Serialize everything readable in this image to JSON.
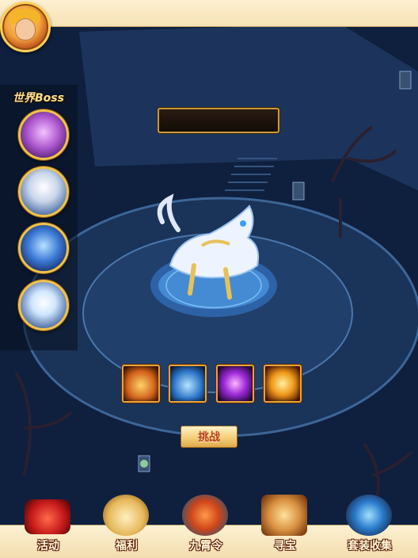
{
  "player": {
    "avatar_icon": "hero-portrait-icon"
  },
  "sidebar": {
    "title": "世界Boss",
    "bosses": [
      {
        "icon": "boss-purple-beast-icon"
      },
      {
        "icon": "boss-white-ape-icon"
      },
      {
        "icon": "boss-blue-dragon-icon"
      },
      {
        "icon": "boss-white-lion-icon"
      }
    ]
  },
  "boss_display": {
    "name": "",
    "icon": "white-qilin-beast-icon"
  },
  "rewards": [
    {
      "icon": "treasure-pack-icon"
    },
    {
      "icon": "blue-book-icon"
    },
    {
      "icon": "purple-orb-icon"
    },
    {
      "icon": "golden-weapon-icon"
    }
  ],
  "challenge_button": {
    "label": "挑战"
  },
  "bottom_nav": [
    {
      "label": "活动",
      "icon": "red-gift-box-icon"
    },
    {
      "label": "福利",
      "icon": "fortune-bag-icon"
    },
    {
      "label": "九霄令",
      "icon": "dragon-token-icon"
    },
    {
      "label": "寻宝",
      "icon": "treasure-chest-icon"
    },
    {
      "label": "套装收集",
      "icon": "armor-set-icon"
    }
  ],
  "colors": {
    "panel_cream": "#fdf1d2",
    "gold_border": "#f0c24a",
    "button_text": "#b8401a",
    "title_gold": "#ffe08a"
  }
}
